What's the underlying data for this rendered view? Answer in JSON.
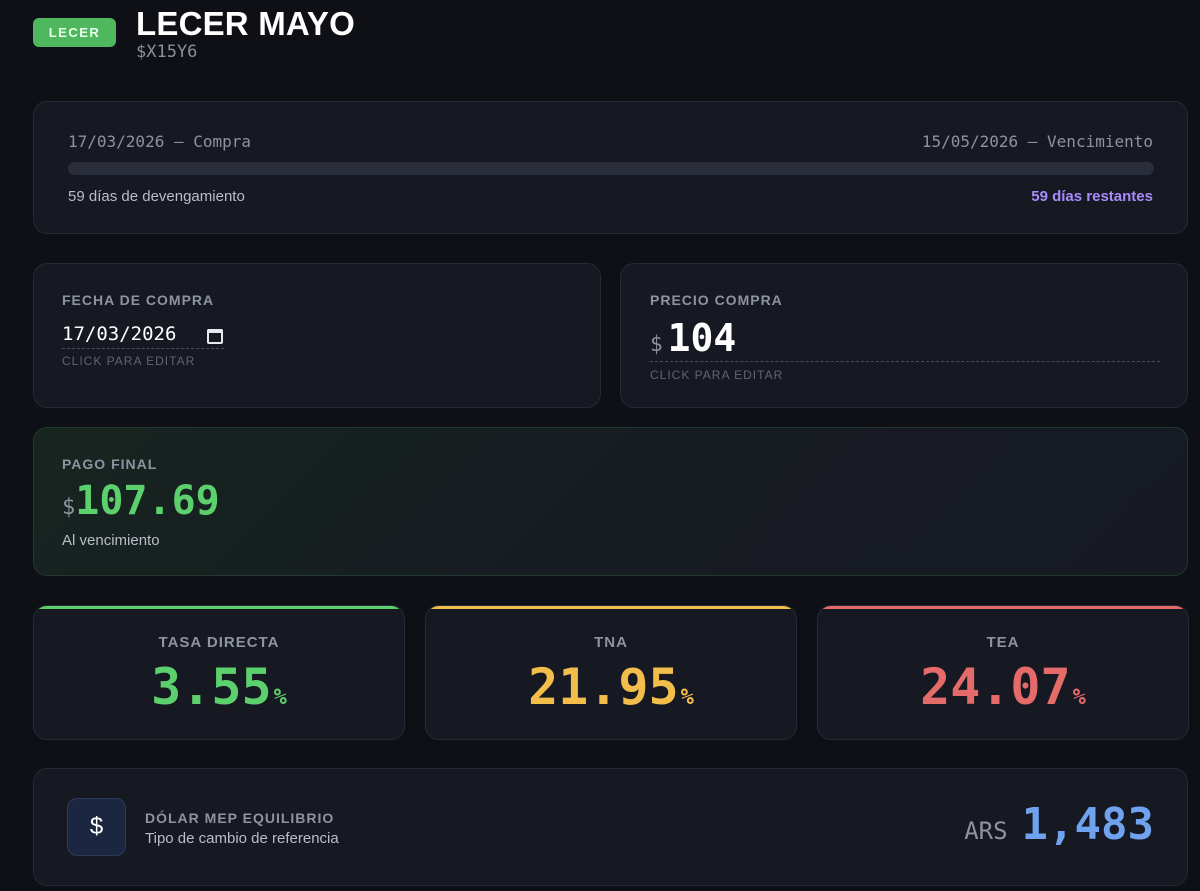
{
  "header": {
    "badge": "LECER",
    "title": "LECER MAYO",
    "ticker": "$X15Y6"
  },
  "timeline": {
    "buy_date_label": "17/03/2026 — Compra",
    "maturity_label": "15/05/2026 — Vencimiento",
    "accrued_text": "59 días de devengamiento",
    "remaining_text": "59 días restantes",
    "progress_fraction": 0
  },
  "fecha_compra": {
    "label": "FECHA DE COMPRA",
    "value": "17/03/2026",
    "hint": "CLICK PARA EDITAR"
  },
  "precio_compra": {
    "label": "PRECIO COMPRA",
    "currency": "$",
    "value": "104",
    "hint": "CLICK PARA EDITAR"
  },
  "pago_final": {
    "label": "PAGO FINAL",
    "currency": "$",
    "value": "107.69",
    "sub": "Al vencimiento"
  },
  "rates": [
    {
      "label": "TASA DIRECTA",
      "value": "3.55",
      "unit": "%",
      "color": "#5cd06c"
    },
    {
      "label": "TNA",
      "value": "21.95",
      "unit": "%",
      "color": "#f2bd4a"
    },
    {
      "label": "TEA",
      "value": "24.07",
      "unit": "%",
      "color": "#e56b6b"
    }
  ],
  "dolar": {
    "icon": "dollar-icon",
    "icon_glyph": "$",
    "label": "DÓLAR MEP EQUILIBRIO",
    "sub": "Tipo de cambio de referencia",
    "currency": "ARS",
    "value": "1,483"
  }
}
